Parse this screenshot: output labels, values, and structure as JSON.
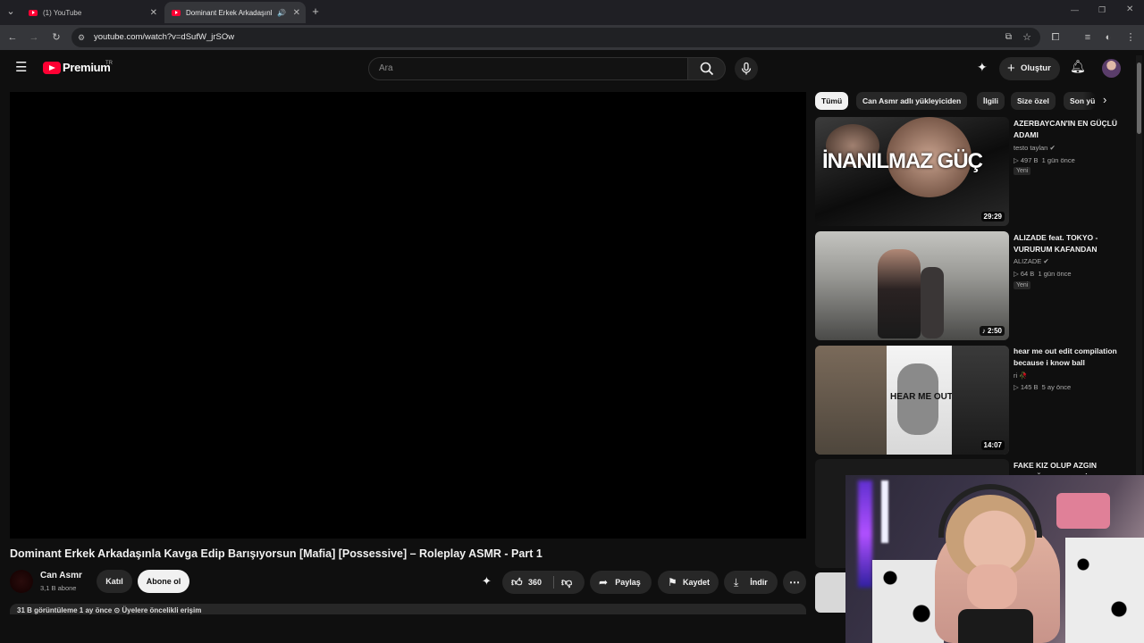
{
  "browser": {
    "tabs": [
      {
        "label": "(1) YouTube"
      },
      {
        "label": "Dominant Erkek Arkadaşınl"
      }
    ],
    "url": "youtube.com/watch?v=dSufW_jrSOw"
  },
  "header": {
    "logo": "Premium",
    "region": "TR",
    "search_placeholder": "Ara",
    "create_label": "Oluştur"
  },
  "video": {
    "title": "Dominant Erkek Arkadaşınla Kavga Edip Barışıyorsun [Mafia] [Possessive] – Roleplay ASMR - Part 1",
    "channel": "Can Asmr",
    "subscribers": "3,1 B abone",
    "join_label": "Katıl",
    "subscribe_label": "Abone ol",
    "likes": "360",
    "share_label": "Paylaş",
    "save_label": "Kaydet",
    "download_label": "İndir",
    "description_preview": "31 B görüntüleme  1 ay önce  ⊙ Üyelere öncelikli erişim"
  },
  "chips": [
    "Tümü",
    "Can Asmr adlı yükleyiciden",
    "İlgili",
    "Size özel",
    "Son yü"
  ],
  "recommendations": [
    {
      "title": "AZERBAYCAN'IN EN GÜÇLÜ ADAMI",
      "channel": "testo taylan",
      "views": "497 B",
      "age": "1 gün önce",
      "badge": "Yeni",
      "duration": "29:29",
      "thumb_text": "İNANILMAZ GÜÇ"
    },
    {
      "title": "ALIZADE feat. TOKYO - VURURUM KAFANDAN",
      "channel": "ALIZADE",
      "views": "64 B",
      "age": "1 gün önce",
      "badge": "Yeni",
      "duration": "2:50"
    },
    {
      "title": "hear me out edit compilation because i know ball",
      "channel": "ri",
      "views": "145 B",
      "age": "5 ay önce",
      "duration": "14:07",
      "thumb_text": "HEAR ME OUT"
    },
    {
      "title": "FAKE KIZ OLUP AZGIN COCUĞU TROLLEDİM"
    }
  ],
  "colors": {
    "brand": "#ff0033",
    "background": "#0f0f0f",
    "chip": "#272727"
  }
}
